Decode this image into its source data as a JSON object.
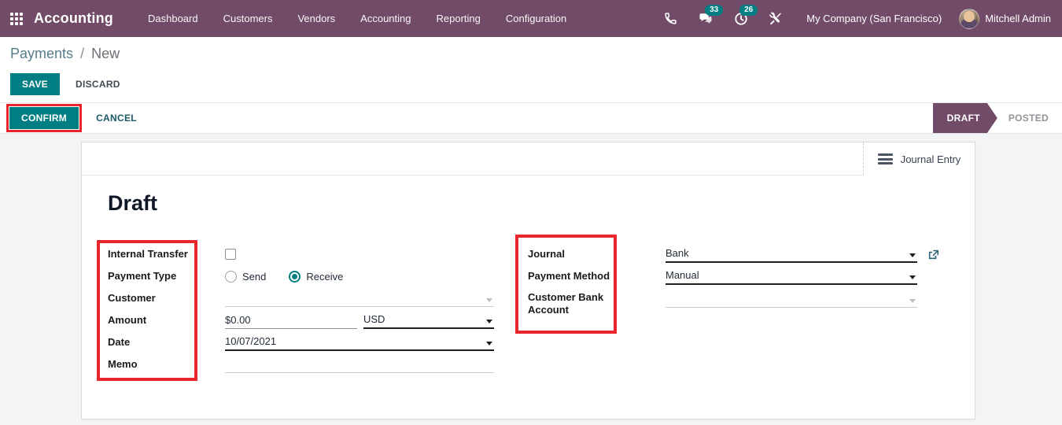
{
  "navbar": {
    "app_name": "Accounting",
    "menu_items": [
      "Dashboard",
      "Customers",
      "Vendors",
      "Accounting",
      "Reporting",
      "Configuration"
    ],
    "messages_badge": "33",
    "activities_badge": "26",
    "company": "My Company (San Francisco)",
    "user": "Mitchell Admin"
  },
  "breadcrumb": {
    "parent": "Payments",
    "separator": "/",
    "current": "New"
  },
  "actions": {
    "save": "SAVE",
    "discard": "DISCARD",
    "confirm": "CONFIRM",
    "cancel": "CANCEL"
  },
  "statusbar": {
    "active_state": "DRAFT",
    "inactive_state": "POSTED"
  },
  "sheet": {
    "button_box": {
      "journal_entry": "Journal Entry"
    },
    "title": "Draft",
    "fields_left": {
      "internal_transfer": {
        "label": "Internal Transfer",
        "checked": false
      },
      "payment_type": {
        "label": "Payment Type",
        "option_send": "Send",
        "option_receive": "Receive",
        "selected": "Receive"
      },
      "customer": {
        "label": "Customer",
        "value": ""
      },
      "amount": {
        "label": "Amount",
        "value": "$0.00",
        "currency": "USD"
      },
      "date": {
        "label": "Date",
        "value": "10/07/2021"
      },
      "memo": {
        "label": "Memo",
        "value": ""
      }
    },
    "fields_right": {
      "journal": {
        "label": "Journal",
        "value": "Bank"
      },
      "payment_method": {
        "label": "Payment Method",
        "value": "Manual"
      },
      "customer_bank_account": {
        "label": "Customer Bank Account",
        "label_line1": "Customer Bank",
        "label_line2": "Account",
        "value": ""
      }
    }
  },
  "colors": {
    "brand": "#714B67",
    "accent": "#017E84",
    "highlight": "#E8262C"
  }
}
